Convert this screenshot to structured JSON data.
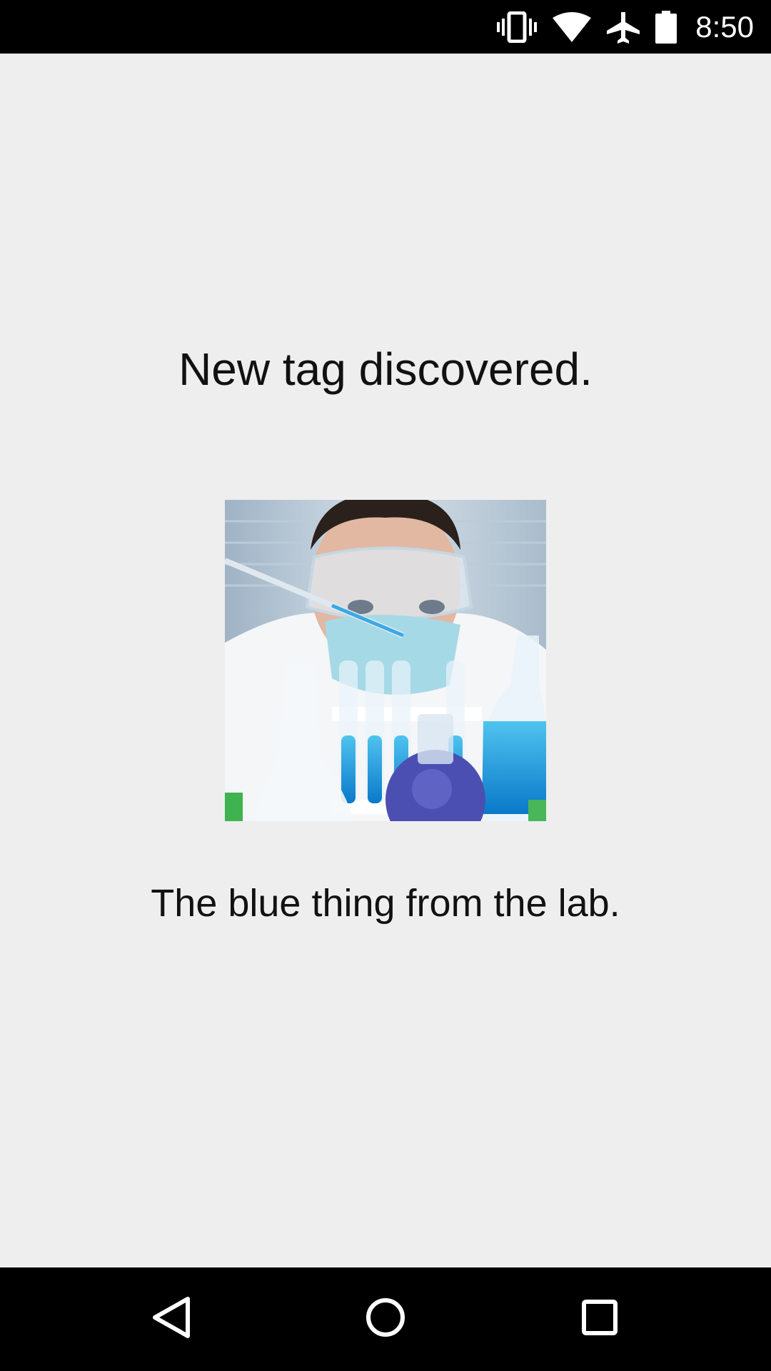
{
  "status_bar": {
    "time": "8:50",
    "icons": [
      "vibrate-icon",
      "wifi-icon",
      "airplane-mode-icon",
      "battery-icon"
    ]
  },
  "screen": {
    "headline": "New tag discovered.",
    "image_subject": "scientist with pipette and blue test tubes",
    "caption": "The blue thing from the lab."
  },
  "nav_bar": {
    "buttons": [
      "back-icon",
      "home-icon",
      "recents-icon"
    ]
  },
  "colors": {
    "background": "#eeeeee",
    "bars": "#000000",
    "text": "#111111"
  }
}
